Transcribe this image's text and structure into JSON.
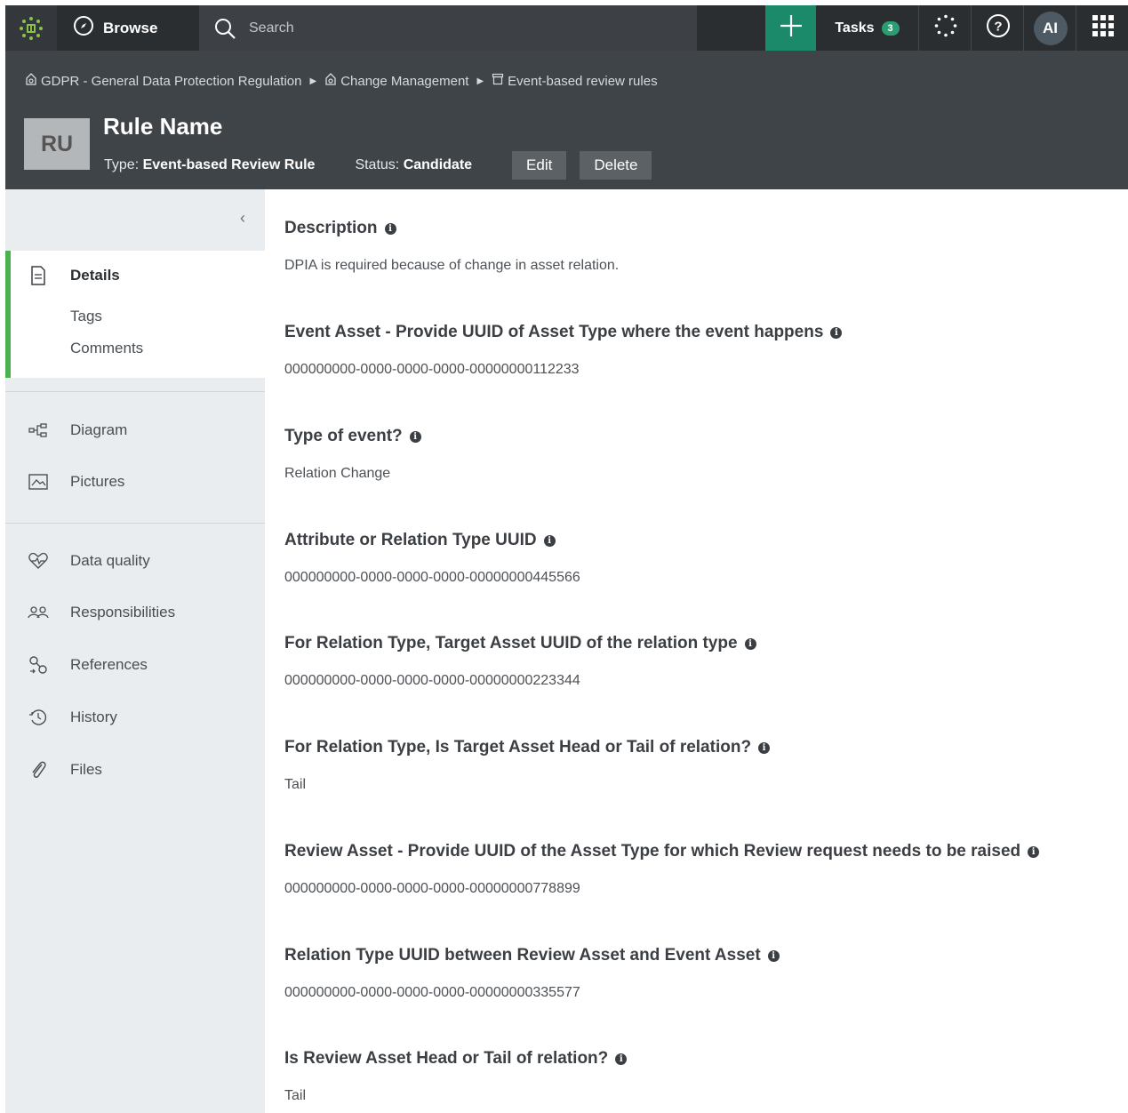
{
  "topbar": {
    "browse_label": "Browse",
    "search_placeholder": "Search",
    "tasks_label": "Tasks",
    "tasks_count": "3",
    "avatar_initials": "AI"
  },
  "breadcrumb": [
    {
      "label": "GDPR - General Data Protection Regulation",
      "icon": "community-icon"
    },
    {
      "label": "Change Management",
      "icon": "community-icon"
    },
    {
      "label": "Event-based review rules",
      "icon": "domain-icon"
    }
  ],
  "asset": {
    "avatar_initials": "RU",
    "title": "Rule Name",
    "type_label": "Type:",
    "type_value": "Event-based Review Rule",
    "status_label": "Status:",
    "status_value": "Candidate",
    "edit_label": "Edit",
    "delete_label": "Delete"
  },
  "sidebar": {
    "collapse_icon": "chevron-left-icon",
    "details": "Details",
    "tags": "Tags",
    "comments": "Comments",
    "diagram": "Diagram",
    "pictures": "Pictures",
    "data_quality": "Data quality",
    "responsibilities": "Responsibilities",
    "references": "References",
    "history": "History",
    "files": "Files"
  },
  "fields": [
    {
      "label": "Description",
      "value": "DPIA is required because of change in asset relation."
    },
    {
      "label": "Event Asset - Provide UUID of Asset Type where the event happens",
      "value": "000000000-0000-0000-0000-00000000112233"
    },
    {
      "label": "Type of event?",
      "value": "Relation Change"
    },
    {
      "label": "Attribute or Relation Type UUID",
      "value": "000000000-0000-0000-0000-00000000445566"
    },
    {
      "label": "For Relation Type, Target Asset UUID of the relation type",
      "value": "000000000-0000-0000-0000-00000000223344"
    },
    {
      "label": "For Relation Type, Is Target Asset Head or Tail of relation?",
      "value": "Tail"
    },
    {
      "label": "Review Asset - Provide UUID of the Asset Type for which Review request needs to be raised",
      "value": "000000000-0000-0000-0000-00000000778899"
    },
    {
      "label": "Relation Type UUID between Review Asset and Event Asset",
      "value": "000000000-0000-0000-0000-00000000335577"
    },
    {
      "label": "Is Review Asset Head or Tail of relation?",
      "value": "Tail"
    }
  ],
  "colors": {
    "topbar_bg": "#2b2e31",
    "header_bg": "#3f4448",
    "accent_green": "#1b8a6b",
    "active_indicator": "#4caf50",
    "sidebar_bg": "#e9edf0"
  }
}
